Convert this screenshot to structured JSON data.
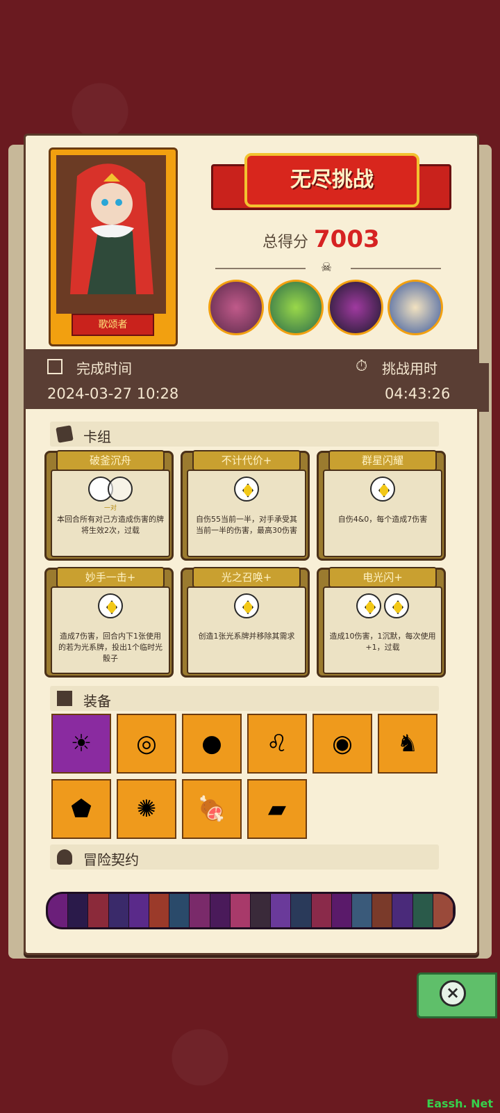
{
  "header": {
    "title": "无尽挑战",
    "score_label": "总得分",
    "score_value": "7003",
    "hero_name": "歌颂者"
  },
  "info": {
    "complete_time_label": "完成时间",
    "complete_time_value": "2024-03-27 10:28",
    "duration_label": "挑战用时",
    "duration_value": "04:43:26"
  },
  "sections": {
    "deck": "卡组",
    "equipment": "装备",
    "contract": "冒险契约"
  },
  "cards": [
    {
      "title": "破釜沉舟",
      "desc": "本回合所有对己方造成伤害的牌将生效2次，过载",
      "gems": 0,
      "sublabel": "一对"
    },
    {
      "title": "不计代价+",
      "desc": "自伤55当前一半，对手承受其当前一半的伤害，最高30伤害",
      "gems": 1,
      "sublabel": ""
    },
    {
      "title": "群星闪耀",
      "desc": "自伤4&0，每个造成7伤害",
      "gems": 1,
      "sublabel": ""
    },
    {
      "title": "妙手一击+",
      "desc": "造成7伤害，回合内下1张使用的若为光系牌，投出1个临时光骰子",
      "gems": 1,
      "sublabel": ""
    },
    {
      "title": "光之召唤+",
      "desc": "创造1张光系牌并移除其需求",
      "gems": 1,
      "sublabel": ""
    },
    {
      "title": "电光闪+",
      "desc": "造成10伤害，1沉默，每次使用+1，过载",
      "gems": 2,
      "sublabel": ""
    }
  ],
  "equipment": [
    {
      "icon": "sun-trophy-icon",
      "glyph": "☀",
      "highlight": true
    },
    {
      "icon": "ring-icon",
      "glyph": "◎",
      "highlight": false
    },
    {
      "icon": "blue-pebbles-icon",
      "glyph": "●",
      "highlight": false
    },
    {
      "icon": "lion-ring-icon",
      "glyph": "♌",
      "highlight": false
    },
    {
      "icon": "red-plate-icon",
      "glyph": "◉",
      "highlight": false
    },
    {
      "icon": "dark-cape-icon",
      "glyph": "♞",
      "highlight": false
    },
    {
      "icon": "blue-shield-icon",
      "glyph": "⬟",
      "highlight": false
    },
    {
      "icon": "blue-orb-key-icon",
      "glyph": "✺",
      "highlight": false
    },
    {
      "icon": "meat-icon",
      "glyph": "🍖",
      "highlight": false
    },
    {
      "icon": "green-tablet-icon",
      "glyph": "▰",
      "highlight": false
    }
  ],
  "contract_colors": [
    "#6b1f7a",
    "#2a1a4a",
    "#8b2a3a",
    "#3a2a6a",
    "#5a2a8a",
    "#9b3a2a",
    "#2a4a6a",
    "#7a2a6a",
    "#4a1a5a",
    "#a83a6a",
    "#3a2a3a",
    "#6a3a9a",
    "#2a3a5a",
    "#8a2a4a",
    "#5a1a6a",
    "#3a5a7a",
    "#7a3a2a",
    "#4a2a7a",
    "#2a5a4a",
    "#9a4a3a"
  ],
  "watermark": "Eassh. Net",
  "colors": {
    "background": "#6a1a20",
    "panel": "#f8efd6",
    "accent_red": "#d62222",
    "card_gold": "#c9a030",
    "equip_orange": "#ef9a1c"
  }
}
